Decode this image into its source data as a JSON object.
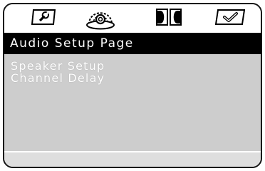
{
  "tabs": [
    {
      "icon": "wrench-icon"
    },
    {
      "icon": "speaker-icon"
    },
    {
      "icon": "dolby-icon"
    },
    {
      "icon": "checkmark-icon"
    }
  ],
  "title": "Audio Setup Page",
  "menu_items": [
    "Speaker Setup",
    "Channel Delay"
  ],
  "colors": {
    "title_bar_bg": "#000000",
    "title_text": "#ffffff",
    "content_bg": "#cdcdcd",
    "footer_bg": "#dedede"
  }
}
